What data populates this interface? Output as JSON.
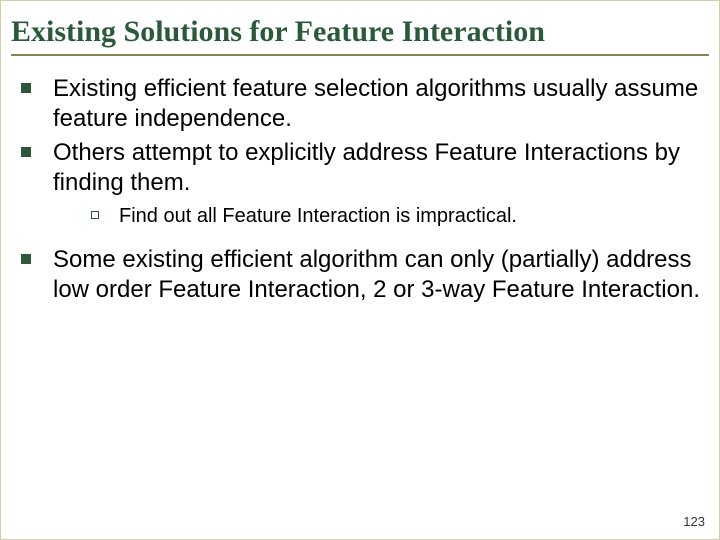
{
  "title": "Existing Solutions for Feature Interaction",
  "bullets": {
    "b1": "Existing efficient feature selection algorithms usually assume feature independence.",
    "b2": "Others attempt to explicitly address Feature Interactions by finding them.",
    "b2_sub1": "Find out all Feature Interaction is impractical.",
    "b3": "Some existing efficient algorithm can only (partially) address low order Feature Interaction, 2 or 3-way Feature Interaction."
  },
  "page_number": "123"
}
